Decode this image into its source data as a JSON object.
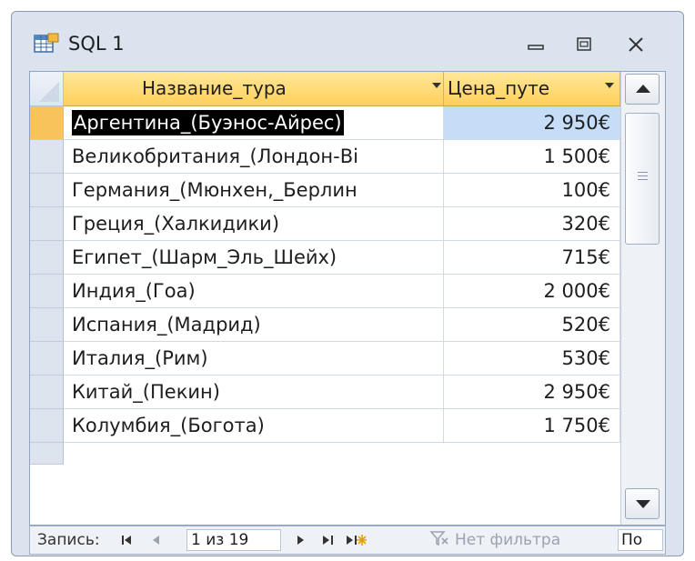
{
  "window": {
    "title": "SQL 1",
    "icons": {
      "app": "datasheet-icon",
      "minimize": "minimize-icon",
      "restore": "restore-icon",
      "close": "close-icon"
    }
  },
  "columns": [
    {
      "label": "Название_тура"
    },
    {
      "label": "Цена_путе"
    }
  ],
  "rows": [
    {
      "name": "Аргентина_(Буэнос-Айрес)",
      "price": "2 950€",
      "current": true
    },
    {
      "name": "Великобритания_(Лондон-Ві",
      "price": "1 500€"
    },
    {
      "name": "Германия_(Мюнхен,_Берлин",
      "price": "100€"
    },
    {
      "name": "Греция_(Халкидики)",
      "price": "320€"
    },
    {
      "name": "Египет_(Шарм_Эль_Шейх)",
      "price": "715€"
    },
    {
      "name": "Индия_(Гоа)",
      "price": "2 000€"
    },
    {
      "name": "Испания_(Мадрид)",
      "price": "520€"
    },
    {
      "name": "Италия_(Рим)",
      "price": "530€"
    },
    {
      "name": "Китай_(Пекин)",
      "price": "2 950€"
    },
    {
      "name": "Колумбия_(Богота)",
      "price": "1 750€"
    }
  ],
  "navigator": {
    "record_label": "Запись:",
    "record_value": "1 из 19",
    "filter_label": "Нет фильтра",
    "search_value": "По",
    "icons": [
      "first-record-icon",
      "prev-record-icon",
      "next-record-icon",
      "last-record-icon",
      "new-record-icon",
      "filter-icon"
    ]
  },
  "colors": {
    "header_bg": "#ffd05a",
    "current_row_selector": "#f7c35a",
    "current_cell": "#c5ddf6",
    "window_frame": "#dbe3ee"
  }
}
